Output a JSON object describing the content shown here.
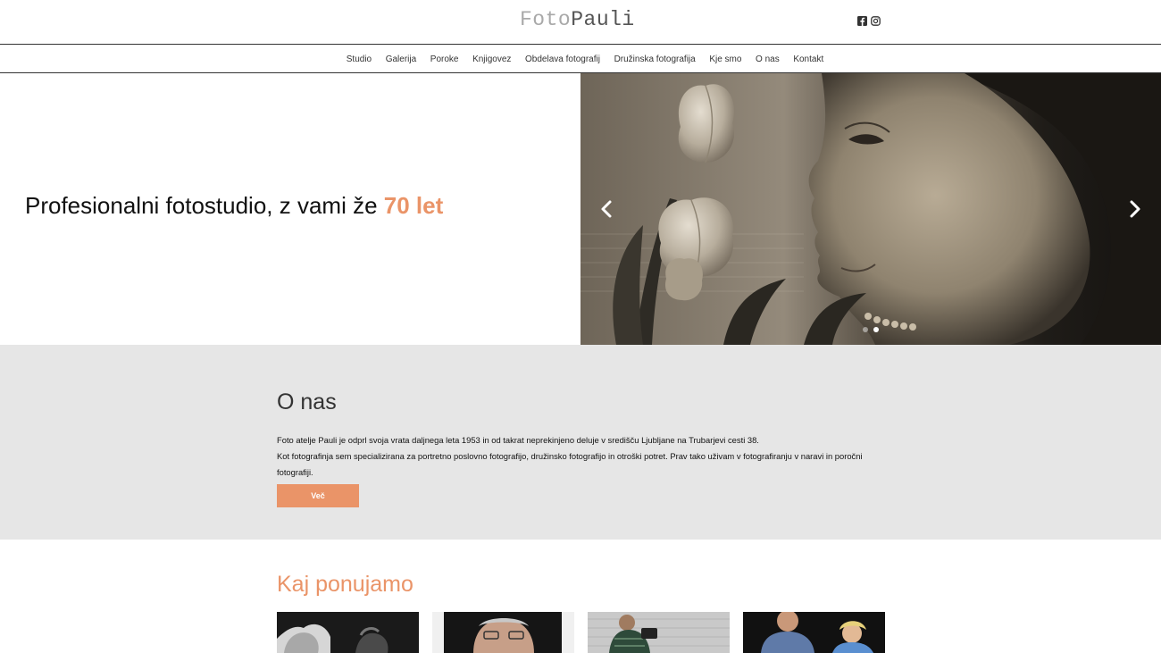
{
  "header": {
    "logo_light": "Foto",
    "logo_dark": "Pauli",
    "social": [
      "facebook-icon",
      "instagram-icon"
    ]
  },
  "nav": {
    "items": [
      "Studio",
      "Galerija",
      "Poroke",
      "Knjigovez",
      "Obdelava fotografij",
      "Družinska fotografija",
      "Kje smo",
      "O nas",
      "Kontakt"
    ]
  },
  "hero": {
    "title_prefix": "Profesionalni fotostudio, z vami že ",
    "title_accent": "70 let",
    "slides": 2,
    "active_slide": 2
  },
  "about": {
    "heading": "O nas",
    "line1": "Foto atelje Pauli je odprl svoja vrata daljnega leta 1953 in od takrat neprekinjeno deluje v središču Ljubljane na Trubarjevi cesti 38.",
    "line2": "Kot fotografinja sem specializirana za portretno poslovno fotografijo, družinsko fotografijo in otroški potret. Prav tako uživam v fotografiranju v naravi in poročni fotografiji.",
    "button": "Več"
  },
  "offer": {
    "heading": "Kaj ponujamo"
  },
  "colors": {
    "accent": "#ea9468",
    "about_bg": "#e6e6e6"
  }
}
